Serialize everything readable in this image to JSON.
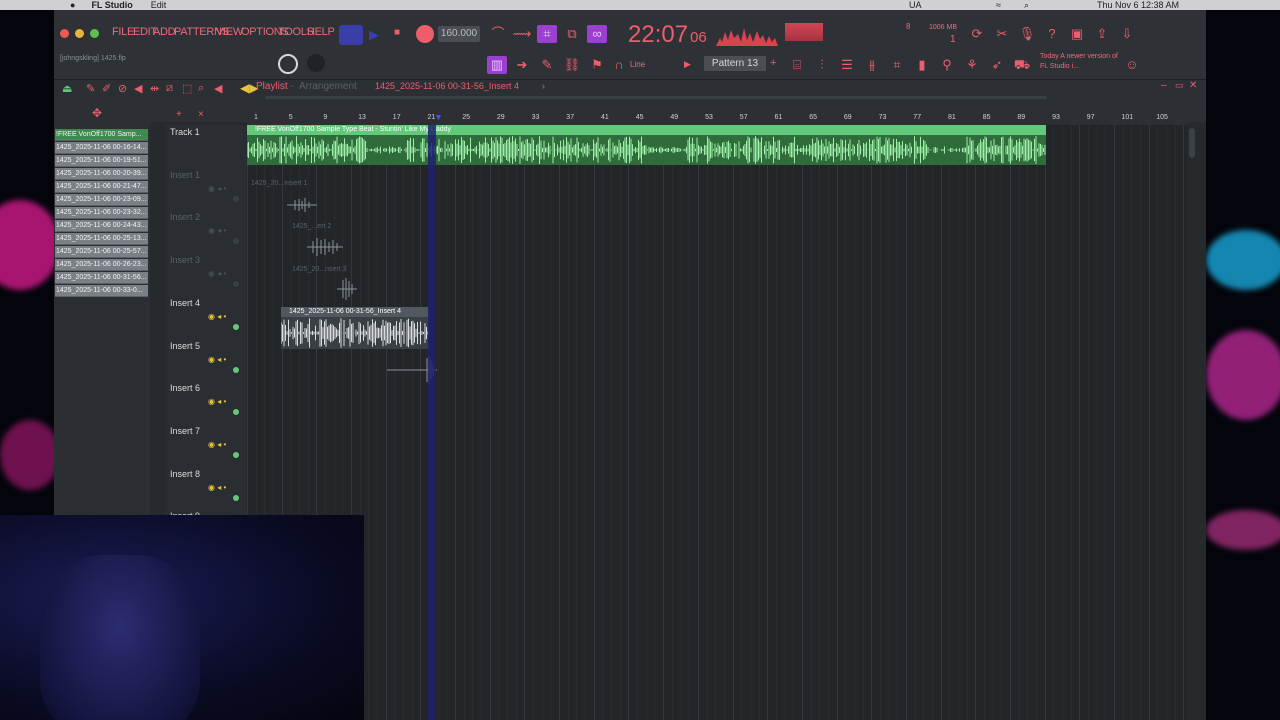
{
  "menubar": {
    "app": "FL Studio",
    "edit": "Edit",
    "kbd": "UA",
    "datetime": "Thu Nov 6  12:38 AM"
  },
  "toolbar": {
    "menus": [
      "FILE",
      "EDIT",
      "ADD",
      "PATTERNS",
      "VIEW",
      "OPTIONS",
      "TOOLS",
      "HELP"
    ],
    "tempo": "160.000",
    "time": "22:07",
    "time_frac": "06",
    "mem": "1006 MB",
    "mem2": "1",
    "mem3": "8",
    "pattern": "Pattern 13",
    "snap": "Line",
    "project": "[johngskling] 1425.flp",
    "news": "Today  A newer version of FL Studio i..."
  },
  "playlist": {
    "title": "Playlist",
    "mode": "Arrangement",
    "clip_path": "1425_2025-11-06 00-31-56_Insert 4"
  },
  "side_items": [
    "!FREE VonOff1700 Samp...",
    "1425_2025-11-06 00-16-14...",
    "1425_2025-11-06 00-19-51...",
    "1425_2025-11-06 00-20-39...",
    "1425_2025-11-06 00-21-47...",
    "1425_2025-11-06 00-23-09...",
    "1425_2025-11-06 00-23-32...",
    "1425_2025-11-06 00-24-43...",
    "1425_2025-11-06 00-25-13...",
    "1425_2025-11-06 00-25-57...",
    "1425_2025-11-06 00-26-23...",
    "1425_2025-11-06 00-31-56...",
    "1425_2025-11-06 00-33-0..."
  ],
  "tracks": [
    {
      "name": "Track 1",
      "dim": false
    },
    {
      "name": "Insert 1",
      "dim": true
    },
    {
      "name": "Insert 2",
      "dim": true
    },
    {
      "name": "Insert 3",
      "dim": true
    },
    {
      "name": "Insert 4",
      "dim": false
    },
    {
      "name": "Insert 5",
      "dim": false
    },
    {
      "name": "Insert 6",
      "dim": false
    },
    {
      "name": "Insert 7",
      "dim": false
    },
    {
      "name": "Insert 8",
      "dim": false
    },
    {
      "name": "Insert 9",
      "dim": false
    }
  ],
  "ruler": [
    "1",
    "5",
    "9",
    "13",
    "17",
    "21",
    "25",
    "29",
    "33",
    "37",
    "41",
    "45",
    "49",
    "53",
    "57",
    "61",
    "65",
    "69",
    "73",
    "77",
    "81",
    "85",
    "89",
    "93",
    "97",
    "101",
    "105"
  ],
  "clips": {
    "beat": "!FREE VonOff1700 Sample Type Beat - Stuntin' Like My Daddy",
    "ins1": "1425_20...Insert 1",
    "ins2": "1425_...ert 2",
    "ins3": "1425_20...nsert 3",
    "ins4": "1425_2025-11-06 00-31-56_Insert 4"
  },
  "colors": {
    "accent": "#f0687a",
    "green_clip": "#63c97a",
    "purple": "#9b3fd1",
    "playhead": "#2c2d8c"
  }
}
